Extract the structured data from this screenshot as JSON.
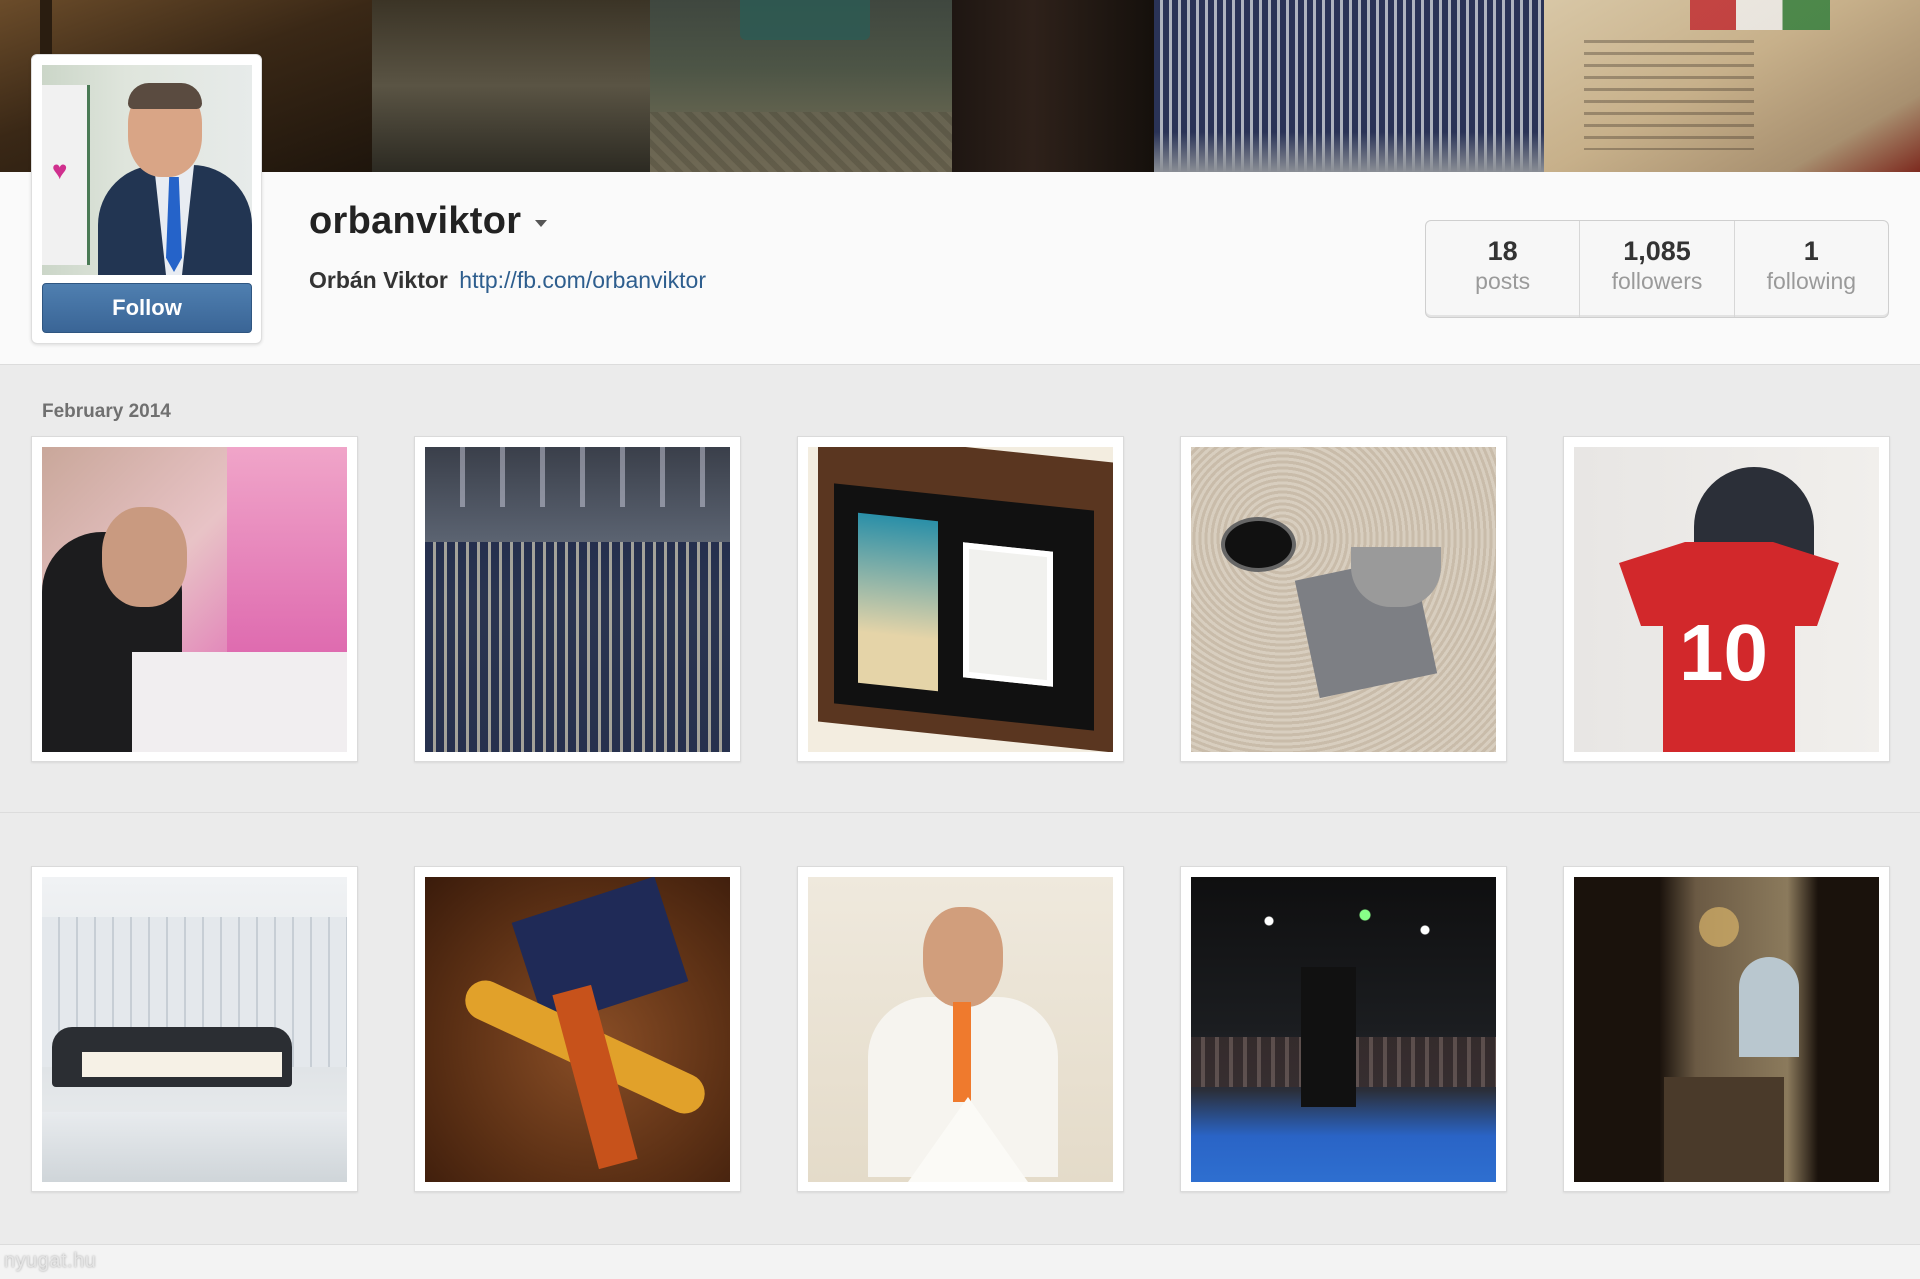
{
  "cover": {
    "tiles": [
      "cover-photo-1",
      "cover-photo-2",
      "cover-photo-3",
      "cover-photo-4",
      "cover-photo-5",
      "cover-photo-6"
    ]
  },
  "profile": {
    "username": "orbanviktor",
    "full_name": "Orbán Viktor",
    "website": "http://fb.com/orbanviktor",
    "follow_label": "Follow",
    "options_icon": "caret-down-icon"
  },
  "stats": [
    {
      "value": "18",
      "label": "posts"
    },
    {
      "value": "1,085",
      "label": "followers"
    },
    {
      "value": "1",
      "label": "following"
    }
  ],
  "feed": {
    "month_label": "February 2014",
    "photos_row1": [
      "photo-children",
      "photo-hall-formation",
      "photo-book-and-ereader",
      "photo-cornerstone",
      "photo-red-jersey"
    ],
    "photos_row2": [
      "photo-meeting-room",
      "photo-passport-ribbons",
      "photo-portrait-scarf",
      "photo-stage-speech",
      "photo-parliament-hall"
    ],
    "jersey_number": "10"
  },
  "watermark": "nyugat.hu",
  "colors": {
    "follow_button": "#3a6596",
    "link": "#2e5e8e",
    "page_background": "#ebebeb"
  }
}
